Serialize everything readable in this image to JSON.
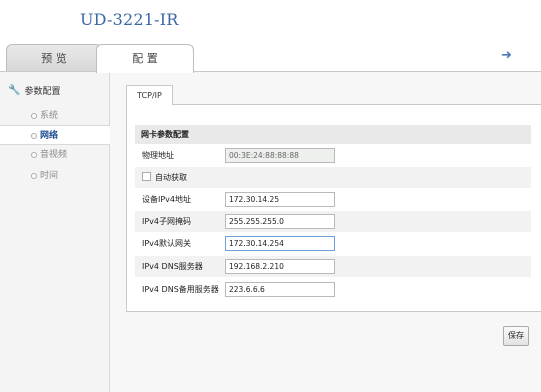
{
  "device": {
    "model": "UD-3221-IR"
  },
  "tabs": {
    "preview": "预 览",
    "config": "配 置"
  },
  "sidebar": {
    "title": "参数配置",
    "items": [
      {
        "label": "系统",
        "active": false
      },
      {
        "label": "网络",
        "active": true
      },
      {
        "label": "音视频",
        "active": false
      },
      {
        "label": "时间",
        "active": false
      }
    ]
  },
  "content": {
    "tab": "TCP/IP",
    "section": "网卡参数配置",
    "fields": {
      "mac": {
        "label": "物理地址",
        "value": "00:3E:24:88:88:88"
      },
      "dhcp": {
        "label": "自动获取",
        "checked": false
      },
      "ipv4": {
        "label": "设备IPv4地址",
        "value": "172.30.14.25"
      },
      "mask": {
        "label": "IPv4子网掩码",
        "value": "255.255.255.0"
      },
      "gateway": {
        "label": "IPv4默认网关",
        "value": "172.30.14.254"
      },
      "dns1": {
        "label": "IPv4 DNS服务器",
        "value": "192.168.2.210"
      },
      "dns2": {
        "label": "IPv4 DNS备用服务器",
        "value": "223.6.6.6"
      }
    },
    "save": "保存"
  },
  "colors": {
    "accent": "#3a67a8",
    "active_nav": "#1f4f91"
  }
}
